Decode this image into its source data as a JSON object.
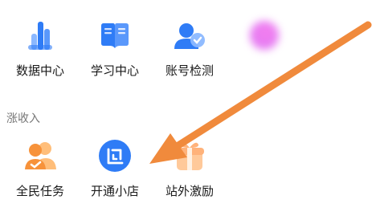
{
  "sections": {
    "top": {
      "title": "",
      "items": [
        {
          "label": "数据中心",
          "icon": "bar-chart-icon"
        },
        {
          "label": "学习中心",
          "icon": "open-book-icon"
        },
        {
          "label": "账号检测",
          "icon": "user-check-icon"
        },
        {
          "label": "",
          "icon": "blurred-icon"
        }
      ]
    },
    "income": {
      "title": "涨收入",
      "items": [
        {
          "label": "全民任务",
          "icon": "people-task-icon"
        },
        {
          "label": "开通小店",
          "icon": "shop-icon"
        },
        {
          "label": "站外激励",
          "icon": "gift-box-icon"
        }
      ]
    }
  },
  "colors": {
    "blue": "#2f7cf6",
    "light_blue": "#8bb8ff",
    "orange": "#f7923a",
    "arrow": "#f08a3c",
    "section_title": "#777777"
  }
}
